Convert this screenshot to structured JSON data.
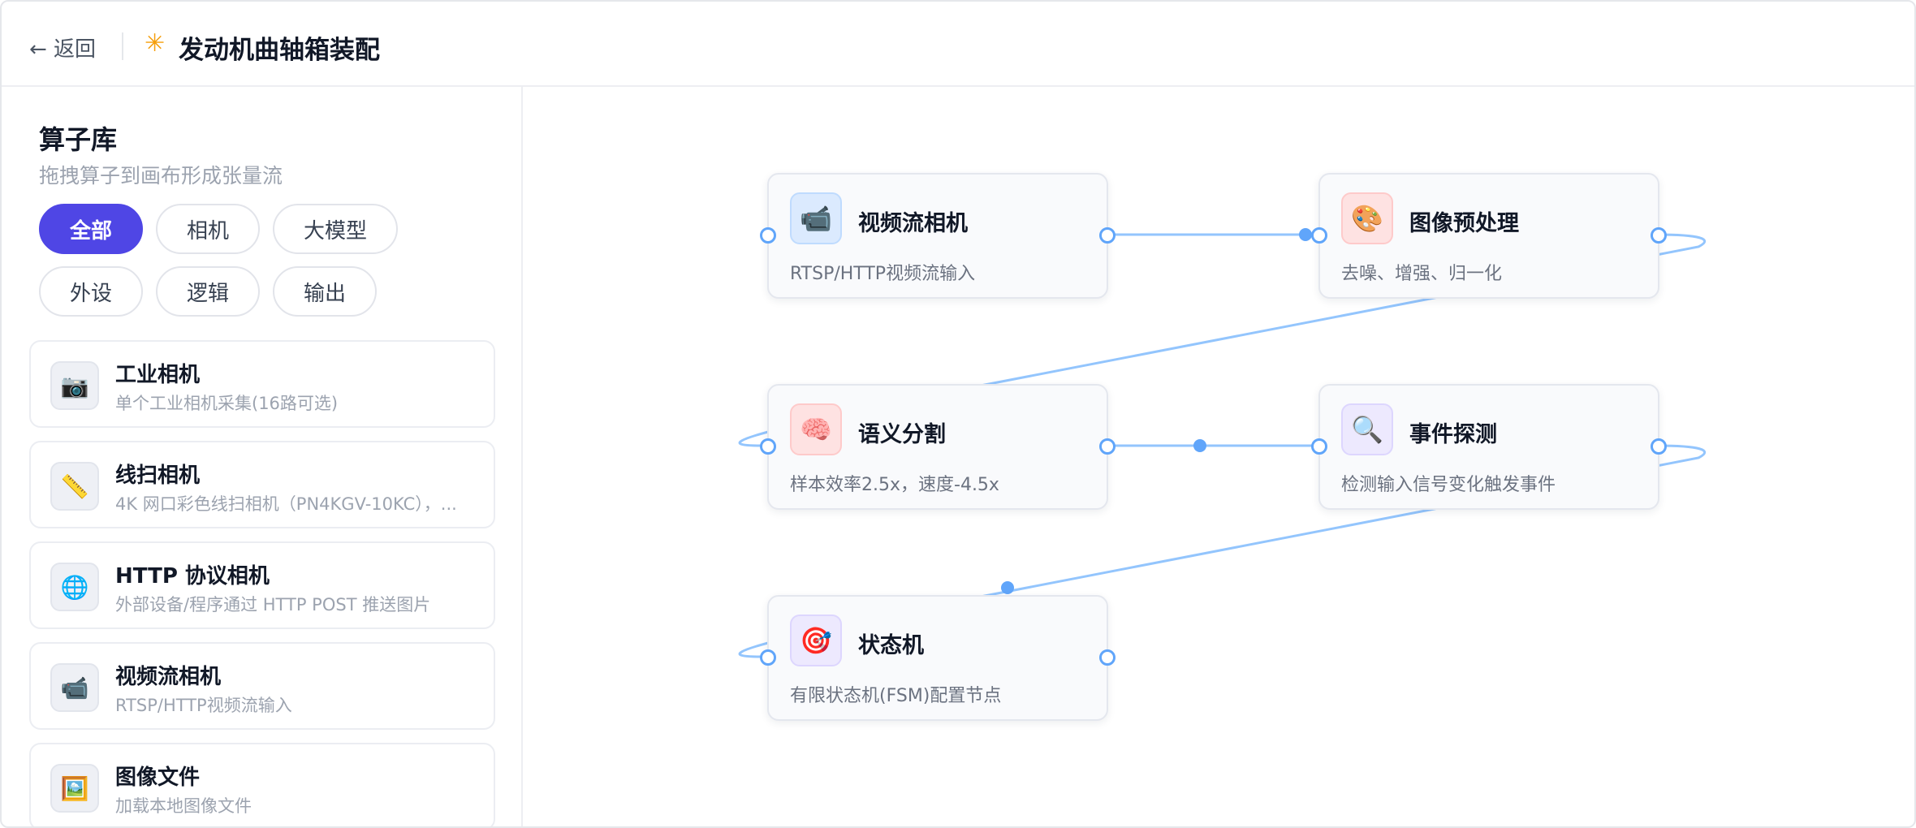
{
  "header": {
    "back_label": "← 返回",
    "title": "发动机曲轴箱装配",
    "title_icon": "sparkle-icon"
  },
  "sidebar": {
    "title": "算子库",
    "subtitle": "拖拽算子到画布形成张量流",
    "filters": [
      "全部",
      "相机",
      "大模型",
      "外设",
      "逻辑",
      "输出"
    ],
    "active_filter": "全部",
    "operators": [
      {
        "icon": "📷",
        "name": "工业相机",
        "desc": "单个工业相机采集(16路可选)"
      },
      {
        "icon": "📏",
        "name": "线扫相机",
        "desc": "4K 网口彩色线扫相机（PN4KGV-10KC），..."
      },
      {
        "icon": "🌐",
        "name": "HTTP 协议相机",
        "desc": "外部设备/程序通过 HTTP POST 推送图片"
      },
      {
        "icon": "📹",
        "name": "视频流相机",
        "desc": "RTSP/HTTP视频流输入"
      },
      {
        "icon": "🖼️",
        "name": "图像文件",
        "desc": "加载本地图像文件"
      }
    ]
  },
  "canvas": {
    "nodes": [
      {
        "icon": "📹",
        "name": "视频流相机",
        "desc": "RTSP/HTTP视频流输入"
      },
      {
        "icon": "🎨",
        "name": "图像预处理",
        "desc": "去噪、增强、归一化"
      },
      {
        "icon": "🧠",
        "name": "语义分割",
        "desc": "样本效率2.5x，速度-4.5x"
      },
      {
        "icon": "🔍",
        "name": "事件探测",
        "desc": "检测输入信号变化触发事件"
      },
      {
        "icon": "🎯",
        "name": "状态机",
        "desc": "有限状态机(FSM)配置节点"
      }
    ],
    "edge_color": "#60a5fa"
  }
}
